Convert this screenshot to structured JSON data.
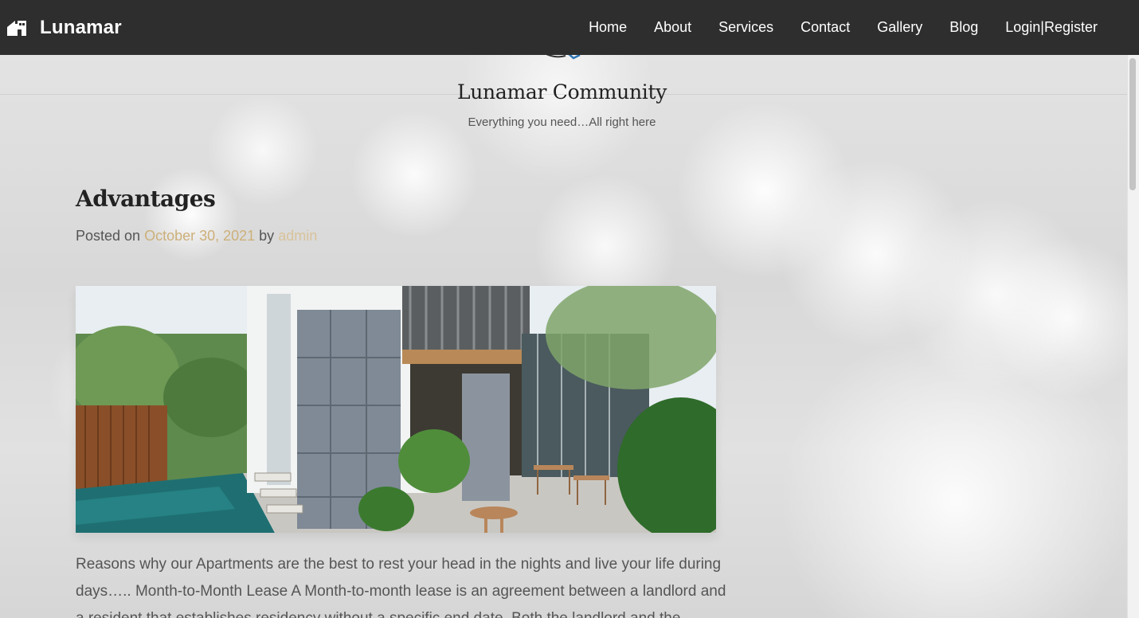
{
  "navbar": {
    "brand_icon": "home-logo-icon",
    "brand_name": "Lunamar",
    "items": [
      {
        "label": "Home"
      },
      {
        "label": "About"
      },
      {
        "label": "Services"
      },
      {
        "label": "Contact"
      },
      {
        "label": "Gallery"
      },
      {
        "label": "Blog"
      },
      {
        "label": "Login|Register"
      }
    ]
  },
  "header": {
    "site_title": "Lunamar Community",
    "tagline": "Everything you need…All right here"
  },
  "post": {
    "title": "Advantages",
    "posted_on_label": "Posted on ",
    "date": "October 30, 2021",
    "by_label": " by ",
    "author": "admin",
    "image_subject": "apartment courtyard with pool, lounge chairs, stone pillars and patio tables",
    "excerpt": "Reasons why our Apartments are the best to rest your head in the nights and live your life during days….. Month-to-Month Lease A Month-to-month lease is an agreement between a landlord and a resident that establishes residency without a specific end date. Both the landlord and the"
  },
  "colors": {
    "navbar_bg": "#2e2e2e",
    "link_accent": "#cdb07a",
    "text_body": "#555555"
  }
}
